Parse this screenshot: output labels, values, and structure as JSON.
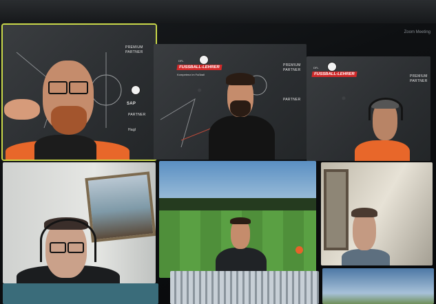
{
  "window": {
    "corner_label": "Zoom Meeting"
  },
  "participants": [
    {
      "id": "p1",
      "active_speaker": true,
      "backdrop": {
        "sponsors": [
          "PREMIUM",
          "PARTNER",
          "PARTNER",
          "Hagl"
        ],
        "brand": "SAP"
      }
    },
    {
      "id": "p2",
      "active_speaker": false,
      "backdrop": {
        "brand_badge": "FUSSBALL-LEHRER",
        "brand_top": "DFL",
        "brand_sub": "Kompetenz im Fußball",
        "sponsors": [
          "PREMIUM",
          "PARTNER",
          "PARTNER"
        ]
      }
    },
    {
      "id": "p3",
      "active_speaker": false,
      "backdrop": {
        "brand_badge": "FUSSBALL-LEHRER",
        "brand_top": "DFL",
        "sponsors": [
          "PREMIUM",
          "PARTNER"
        ]
      }
    },
    {
      "id": "p4",
      "active_speaker": false,
      "scene": "room-with-painting"
    },
    {
      "id": "p5",
      "active_speaker": false,
      "scene": "football-pitch"
    },
    {
      "id": "p6",
      "active_speaker": false,
      "scene": "home-office"
    },
    {
      "id": "p7",
      "active_speaker": false,
      "scene": "unknown"
    },
    {
      "id": "p8",
      "active_speaker": false,
      "scene": "building"
    },
    {
      "id": "p9",
      "active_speaker": false,
      "scene": "outdoor-sky"
    }
  ],
  "colors": {
    "active_speaker_border": "#c9d84a",
    "brand_red": "#d12a2a",
    "jacket_orange": "#e8672a"
  },
  "icons": [
    "football-icon"
  ]
}
